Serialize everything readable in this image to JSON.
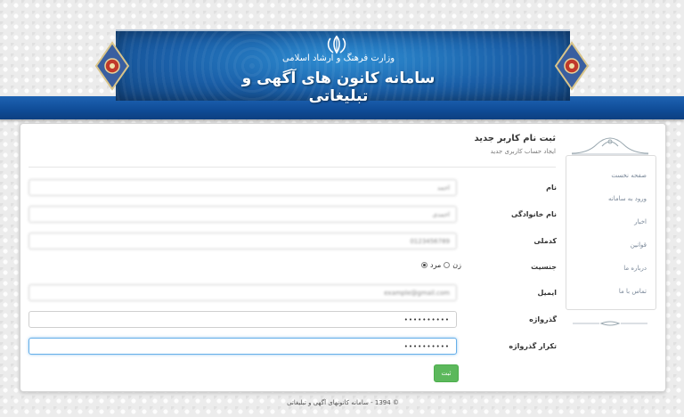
{
  "header": {
    "ministry": "وزارت فرهنگ و ارشاد اسلامی",
    "system_title": "سامانه کانون های آگهی و تبلیغاتی"
  },
  "form": {
    "heading": "ثبت نام کاربر جدید",
    "subheading": "ایجاد حساب کاربری جدید",
    "fields": [
      {
        "label": "نام",
        "value": "احمد"
      },
      {
        "label": "نام خانوادگی",
        "value": "احمدی"
      },
      {
        "label": "کدملی",
        "value": "0123456789"
      },
      {
        "label": "ایمیل",
        "value": "example@gmail.com"
      },
      {
        "label": "گذرواژه",
        "value": "••••••••••"
      },
      {
        "label": "تکرار گذرواژه",
        "value": "••••••••••"
      }
    ],
    "gender": {
      "label": "جنسیت",
      "female": "زن",
      "male": "مرد",
      "selected": "male"
    },
    "submit_label": "ثبت"
  },
  "sidebar": {
    "items": [
      {
        "label": "صفحه نخست"
      },
      {
        "label": "ورود به سامانه"
      },
      {
        "label": "اخبار"
      },
      {
        "label": "قوانین"
      },
      {
        "label": "درباره ما"
      },
      {
        "label": "تماس با ما"
      }
    ]
  },
  "footer": {
    "text": "© 1394 - سامانه کانونهای آگهی و تبلیغاتی"
  },
  "colors": {
    "header_blue": "#1a5fa8",
    "button_green": "#5cb85c",
    "focus_blue": "#66afe9"
  }
}
